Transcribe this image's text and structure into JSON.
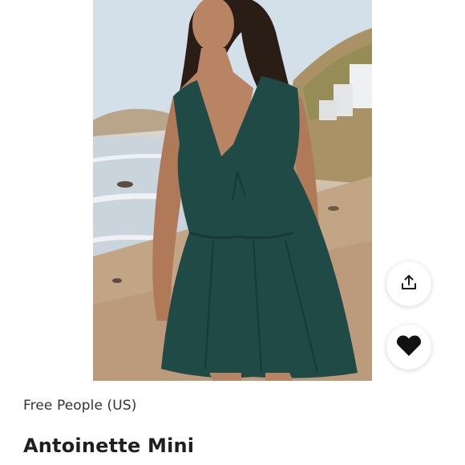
{
  "product": {
    "brand": "Free People (US)",
    "title": "Antoinette Mini"
  },
  "actions": {
    "share_icon": "share-icon",
    "like_icon": "heart-icon"
  },
  "colors": {
    "dress": "#1f4a46",
    "heart": "#111111",
    "text": "#1f1f1f"
  }
}
